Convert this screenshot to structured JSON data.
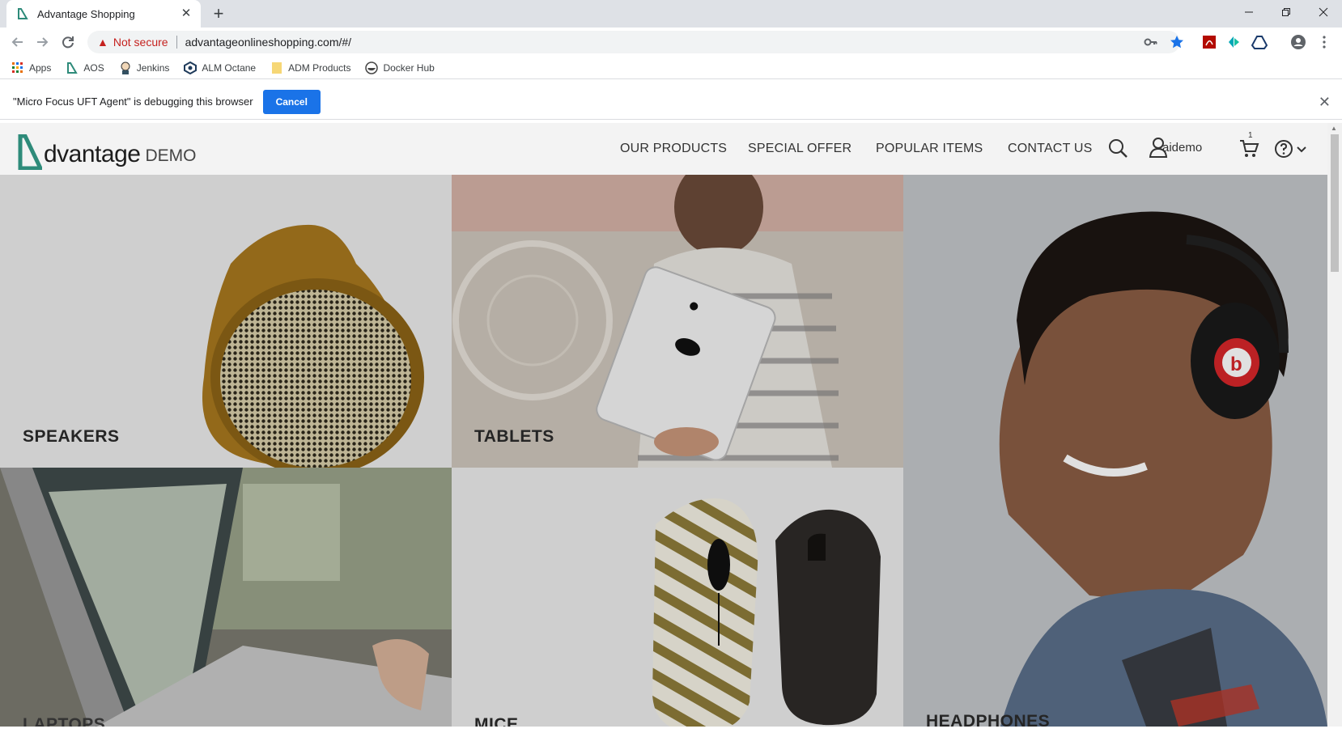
{
  "browser": {
    "tab_title": "Advantage Shopping",
    "omnibox": {
      "security_label": "Not secure",
      "url": "advantageonlineshopping.com/#/"
    },
    "bookmarks": [
      {
        "label": "Apps",
        "icon": "apps-grid-icon"
      },
      {
        "label": "AOS",
        "icon": "aos-logo-icon"
      },
      {
        "label": "Jenkins",
        "icon": "jenkins-icon"
      },
      {
        "label": "ALM Octane",
        "icon": "alm-octane-icon"
      },
      {
        "label": "ADM Products",
        "icon": "folder-icon"
      },
      {
        "label": "Docker Hub",
        "icon": "docker-icon"
      }
    ],
    "infobar": {
      "message": "\"Micro Focus UFT Agent\" is debugging this browser",
      "cancel_label": "Cancel"
    }
  },
  "site": {
    "logo": {
      "word": "dvantage",
      "demo": "DEMO"
    },
    "nav": [
      "OUR PRODUCTS",
      "SPECIAL OFFER",
      "POPULAR ITEMS",
      "CONTACT US"
    ],
    "username": "aidemo",
    "cart_count": "1",
    "categories": {
      "speakers": "SPEAKERS",
      "tablets": "TABLETS",
      "headphones": "HEADPHONES",
      "laptops": "LAPTOPS",
      "mice": "MICE"
    }
  },
  "colors": {
    "brand_green": "#2e8b7a",
    "accent_blue": "#1a73e8",
    "warning_red": "#c5221f"
  }
}
